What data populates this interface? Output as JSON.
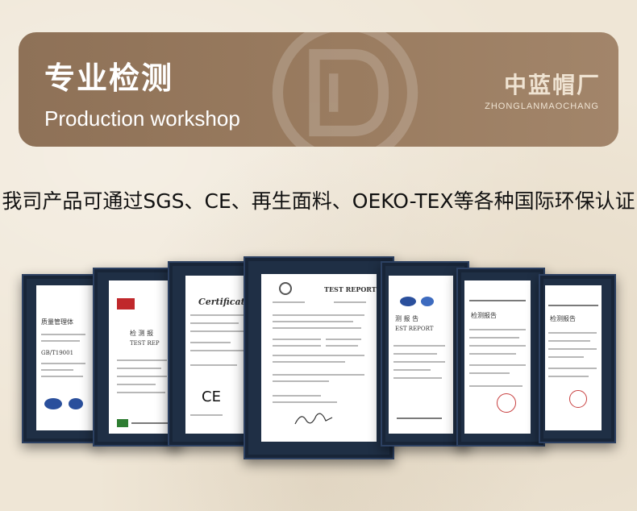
{
  "banner": {
    "title": "专业检测",
    "subtitle": "Production workshop",
    "brand_cn": "中蓝帽厂",
    "brand_en": "ZHONGLANMAOCHANG",
    "color": "#9a7c60"
  },
  "headline": "我司产品可通过SGS、CE、再生面料、OEKO-TEX等各种国际环保认证",
  "certificates": {
    "frame_color": "#1f2f45",
    "c1_title": "质量管理体",
    "c1_line": "GB/T19001",
    "c2_title": "检 测 报",
    "c2_sub": "TEST REP",
    "c3_title": "Certificate o",
    "c3_mark": "CE",
    "c4_title": "TEST REPORT",
    "c5_title": "测 报 告",
    "c5_sub": "EST REPORT",
    "c6_title": "检测报告",
    "c7_title": "检测报告"
  }
}
